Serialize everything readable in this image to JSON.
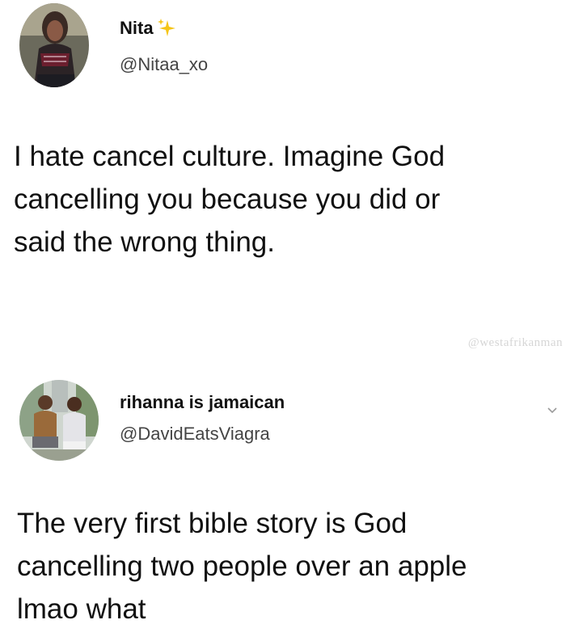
{
  "tweets": [
    {
      "display_name": "Nita",
      "handle": "@Nitaa_xo",
      "text": "I hate cancel culture. Imagine God cancelling you because you did or said the wrong thing.",
      "text_lines": [
        "I hate cancel culture. Imagine God",
        "cancelling you because you did or",
        "said the wrong thing."
      ],
      "name_icon": "sparkles-icon"
    },
    {
      "display_name": "rihanna is jamaican",
      "handle": "@DavidEatsViagra",
      "text": "The very first bible story is God cancelling two people over an apple lmao what",
      "text_lines": [
        "The very first bible story is God",
        "cancelling two people over an apple",
        "lmao what"
      ],
      "menu_icon": "chevron-down-icon"
    }
  ],
  "watermark": "@westafrikanman",
  "colors": {
    "text": "#111111",
    "handle": "#444444",
    "sparkle": "#f5c518",
    "watermark": "#d6d6d6"
  }
}
